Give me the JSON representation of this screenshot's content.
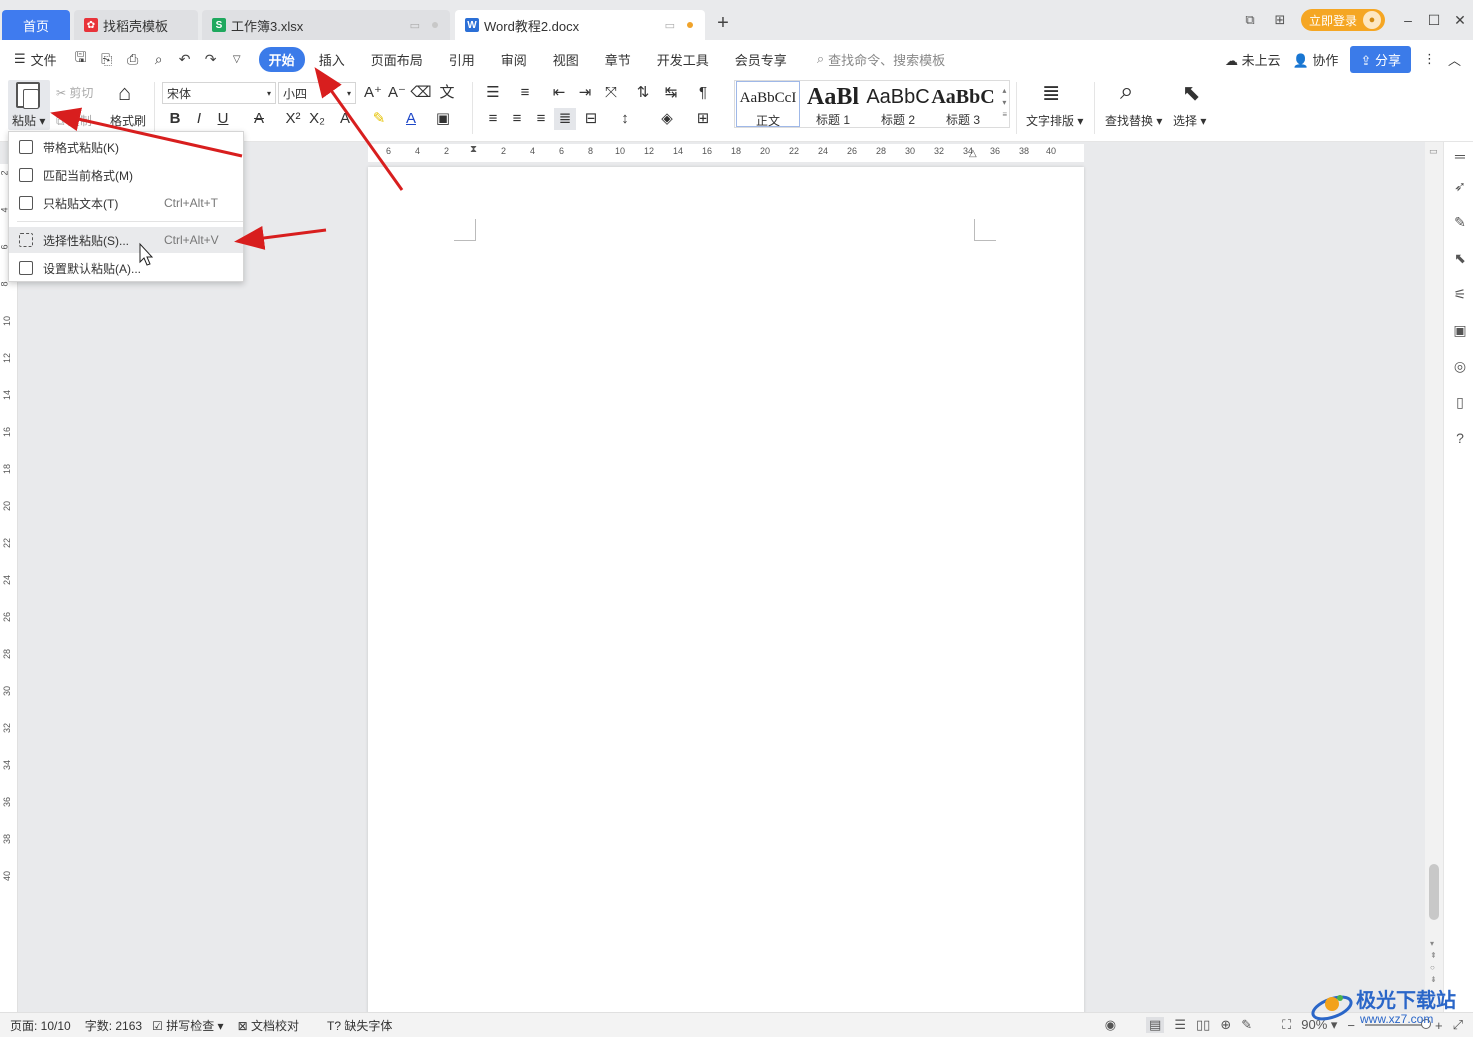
{
  "titlebar": {
    "home_tab": "首页",
    "tabs": [
      {
        "label": "找稻壳模板",
        "icon": "docer-icon"
      },
      {
        "label": "工作簿3.xlsx",
        "icon": "spreadsheet-icon"
      },
      {
        "label": "Word教程2.docx",
        "icon": "word-doc-icon"
      }
    ],
    "login_label": "立即登录"
  },
  "menubar": {
    "file_label": "文件",
    "tabs": [
      "开始",
      "插入",
      "页面布局",
      "引用",
      "审阅",
      "视图",
      "章节",
      "开发工具",
      "会员专享"
    ],
    "search_placeholder": "查找命令、搜索模板",
    "cloud_label": "未上云",
    "collab_label": "协作",
    "share_label": "分享"
  },
  "ribbon": {
    "paste_label": "粘贴",
    "cut_label": "剪切",
    "copy_label": "复制",
    "format_painter_label": "格式刷",
    "font_name": "宋体",
    "font_size": "小四",
    "styles": [
      {
        "sample": "AaBbCcI",
        "name": "正文"
      },
      {
        "sample": "AaBl",
        "name": "标题 1"
      },
      {
        "sample": "AaBbC",
        "name": "标题 2"
      },
      {
        "sample": "AaBbC",
        "name": "标题 3"
      }
    ],
    "text_layout_label": "文字排版",
    "find_replace_label": "查找替换",
    "select_label": "选择"
  },
  "ruler": {
    "h_numbers": [
      "6",
      "4",
      "2",
      "2",
      "4",
      "6",
      "8",
      "10",
      "12",
      "14",
      "16",
      "18",
      "20",
      "22",
      "24",
      "26",
      "28",
      "30",
      "32",
      "34",
      "36",
      "38",
      "40"
    ],
    "v_numbers": [
      "2",
      "4",
      "6",
      "8",
      "10",
      "12",
      "14",
      "16",
      "18",
      "20",
      "22",
      "24",
      "26",
      "28",
      "30",
      "32",
      "34",
      "36",
      "38",
      "40"
    ]
  },
  "paste_menu": {
    "items": [
      {
        "label": "带格式粘贴(K)",
        "shortcut": ""
      },
      {
        "label": "匹配当前格式(M)",
        "shortcut": ""
      },
      {
        "label": "只粘贴文本(T)",
        "shortcut": "Ctrl+Alt+T"
      },
      {
        "label": "选择性粘贴(S)...",
        "shortcut": "Ctrl+Alt+V"
      },
      {
        "label": "设置默认粘贴(A)...",
        "shortcut": ""
      }
    ]
  },
  "statusbar": {
    "page": "页面: 10/10",
    "word_count": "字数: 2163",
    "spell_check": "拼写检查",
    "proofread": "文档校对",
    "missing_font": "缺失字体",
    "zoom": "90%"
  },
  "watermark": {
    "text": "极光下载站",
    "url": "www.xz7.com"
  },
  "colors": {
    "accent": "#3b7be9",
    "home_tab": "#3f7bef",
    "login": "#f5a623",
    "annotation_arrow": "#d81e1e"
  }
}
